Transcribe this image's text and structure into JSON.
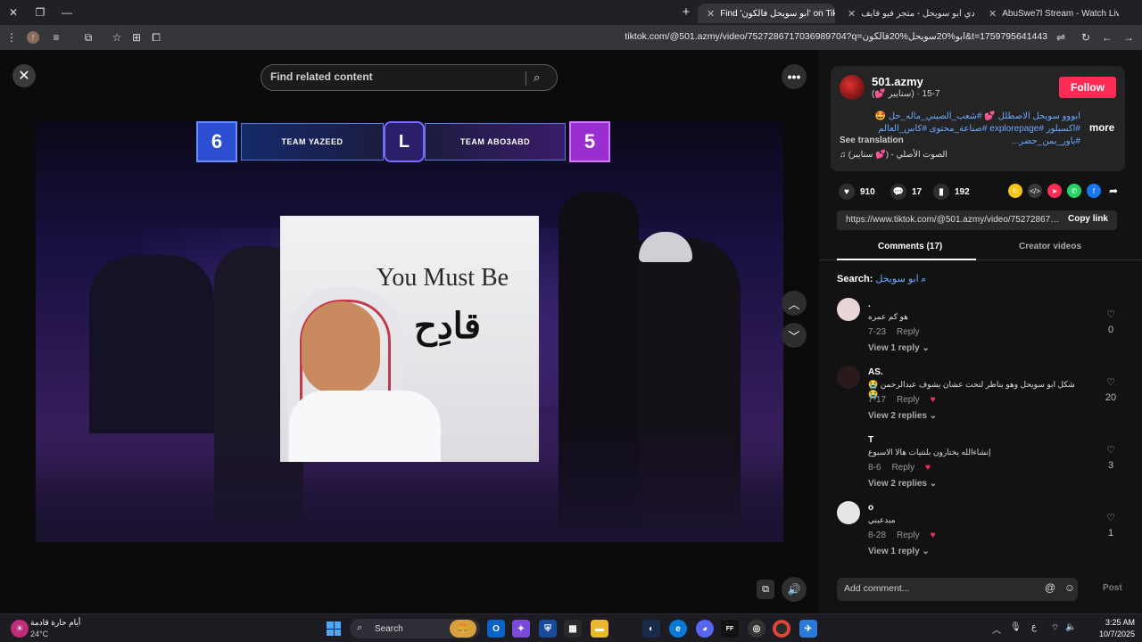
{
  "browser": {
    "tabs": [
      {
        "label": "AbuSwe7l Stream - Watch Live"
      },
      {
        "label": "هودي ابو سويحل - متجر فيو فايف"
      },
      {
        "label": "Find 'ابو سويحل فالكون' on TikTok"
      }
    ],
    "url": "tiktok.com/@501.azmy/video/7527286717036989704?q=ابو%20سويحل%20فالكون&t=1759795641443"
  },
  "player": {
    "search_placeholder": "Find related content",
    "scoreboard": {
      "left_score": "6",
      "left_team": "TEAM YAZEED",
      "right_team": "TEAM ABO3ABD",
      "right_score": "5"
    },
    "meme": {
      "text_en": "You Must Be",
      "text_ar": "قادِح"
    }
  },
  "post": {
    "username": "501.azmy",
    "subline": "(💕 سنايبر) · 7-15",
    "follow_label": "Follow",
    "caption": "ابووو سويحل الاصطلل 💕 #شعب_الصيني_ماله_حل 🤩 #اكسبلور #explorepage #صناعة_محتوى #كاس_العالم #باور_بمن_حضر...",
    "more_label": "more",
    "see_translation": "See translation",
    "music": "♫  الصوت الأصلي - (💕 سنايبر)",
    "likes": "910",
    "comments_count": "17",
    "saves": "192",
    "link": "https://www.tiktok.com/@501.azmy/video/752728671...",
    "copy_link": "Copy link"
  },
  "tabs": {
    "comments": "Comments (17)",
    "creator_videos": "Creator videos"
  },
  "search": {
    "label": "Search:",
    "query": "ابو سويحل"
  },
  "comments": [
    {
      "name": ".",
      "text": "هو كم عمره",
      "date": "7-23",
      "reply": "Reply",
      "replies": "View 1 reply",
      "likes": "0"
    },
    {
      "name": "AS.",
      "text": "شكل ابو سويحل وهو يناظر لتحت عشان يشوف عبدالرحمن 😭😭",
      "date": "7-17",
      "reply": "Reply",
      "replies": "View 2 replies",
      "likes": "20"
    },
    {
      "name": "T",
      "text": "إنشاءالله يختارون بلنتيات هالا الاسبوع",
      "date": "8-6",
      "reply": "Reply",
      "replies": "View 2 replies",
      "likes": "3"
    },
    {
      "name": "o",
      "text": "مبدعيني",
      "date": "8-28",
      "reply": "Reply",
      "replies": "View 1 reply",
      "likes": "1"
    }
  ],
  "comment_box": {
    "placeholder": "Add comment...",
    "post_label": "Post"
  },
  "taskbar": {
    "weather_title": "أيام حارة قادمة",
    "weather_temp": "24°C",
    "search_label": "Search",
    "time": "3:25 AM",
    "date": "10/7/2025",
    "lang": "ع"
  },
  "colors": {
    "accent": "#fe2c55",
    "link": "#6aa8ff",
    "panel_bg": "#121212"
  }
}
